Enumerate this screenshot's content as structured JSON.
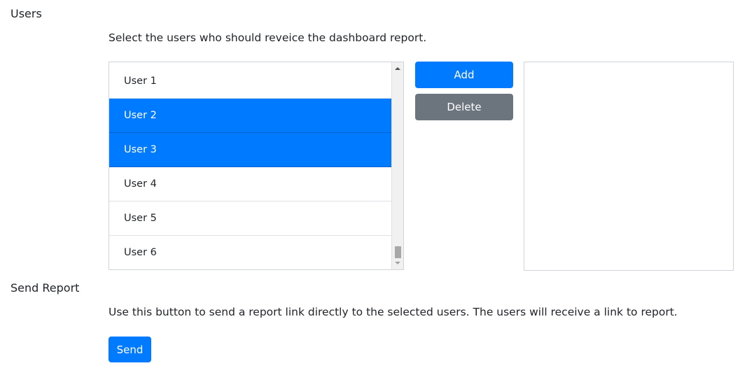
{
  "users_section": {
    "title": "Users",
    "description": "Select the users who should reveice the dashboard report.",
    "available_users": [
      {
        "label": "User 1",
        "selected": false
      },
      {
        "label": "User 2",
        "selected": true
      },
      {
        "label": "User 3",
        "selected": true
      },
      {
        "label": "User 4",
        "selected": false
      },
      {
        "label": "User 5",
        "selected": false
      },
      {
        "label": "User 6",
        "selected": false
      }
    ],
    "add_label": "Add",
    "delete_label": "Delete",
    "selected_users": []
  },
  "send_section": {
    "title": "Send Report",
    "description": "Use this button to send a report link directly to the selected users. The users will receive a link to report.",
    "send_label": "Send"
  },
  "colors": {
    "primary": "#007bff",
    "secondary": "#6c757d",
    "border": "#ced4da"
  }
}
